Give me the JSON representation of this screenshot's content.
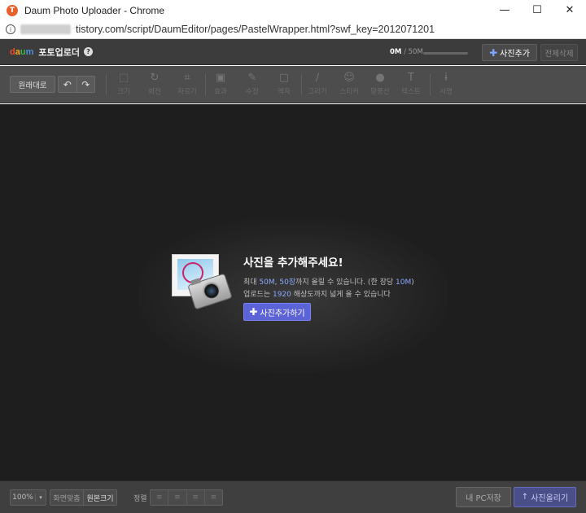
{
  "window": {
    "title": "Daum Photo Uploader - Chrome",
    "app_icon": "T",
    "minimize": "—",
    "maximize": "☐",
    "close": "✕"
  },
  "address": {
    "url": "tistory.com/script/DaumEditor/pages/PastelWrapper.html?swf_key=2012071201"
  },
  "header": {
    "logo": {
      "d": "d",
      "a": "a",
      "u": "u",
      "m": "m"
    },
    "app_name": "포토업로더",
    "help": "?",
    "usage_used": "0M",
    "usage_total": " / 50M",
    "add_photo_label": "사진추가",
    "delete_all_label": "전체삭제"
  },
  "toolbar": {
    "original_label": "원래대로",
    "undo_icon": "↶",
    "redo_icon": "↷",
    "tools": [
      {
        "label": "크기",
        "icon": "⬚"
      },
      {
        "label": "회전",
        "icon": "↻"
      },
      {
        "label": "자르기",
        "icon": "⌗"
      },
      {
        "label": "효과",
        "icon": "▣"
      },
      {
        "label": "수정",
        "icon": "✎"
      },
      {
        "label": "액자",
        "icon": "▢"
      },
      {
        "label": "그리기",
        "icon": "∕"
      },
      {
        "label": "스티커",
        "icon": "☺"
      },
      {
        "label": "말풍선",
        "icon": "●"
      },
      {
        "label": "텍스트",
        "icon": "T"
      },
      {
        "label": "서명",
        "icon": "ɨ"
      }
    ]
  },
  "empty_state": {
    "title": "사진을 추가해주세요!",
    "line1_prefix": "최대 ",
    "line1_size": "50M",
    "line1_sep": ", ",
    "line1_count": "50장",
    "line1_mid": "까지 올릴 수 있습니다. (한 장당 ",
    "line1_per": "10M",
    "line1_end": ")",
    "line2_prefix": "업로드는 ",
    "line2_res": "1920",
    "line2_end": " 해상도까지 넓게 올 수 있습니다",
    "button_label": "사진추가하기"
  },
  "bottom": {
    "zoom_value": "100%",
    "zoom_arrow": "▾",
    "fit_screen": "화면맞춤",
    "original_size": "원본크기",
    "align_label": "정렬",
    "align_icons": [
      "≡",
      "≡",
      "≡",
      "≡"
    ],
    "save_pc_label": "내 PC저장",
    "upload_label": "사진올리기",
    "upload_icon": "↑"
  },
  "colors": {
    "accent": "#5b63d6",
    "highlight": "#8ba9ff",
    "canvas_bg": "#1e1e1e"
  }
}
